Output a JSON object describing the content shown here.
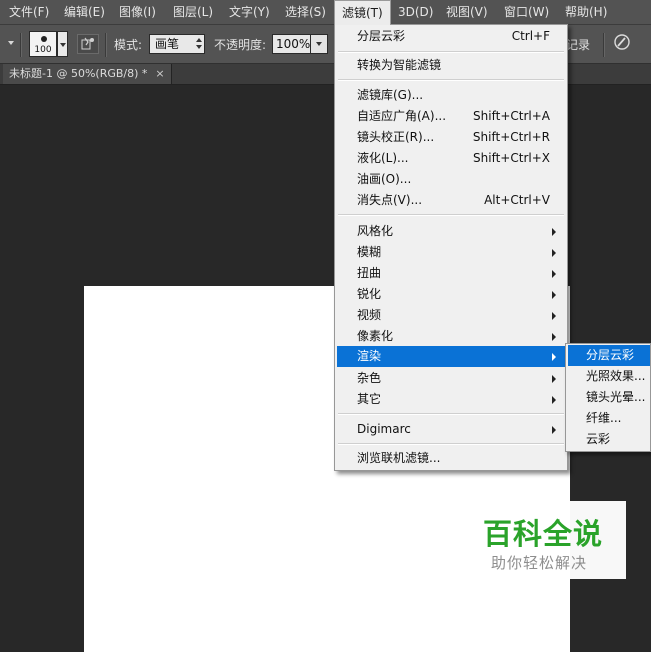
{
  "menubar": {
    "items": [
      {
        "label": "文件(F)"
      },
      {
        "label": "编辑(E)"
      },
      {
        "label": "图像(I)"
      },
      {
        "label": "图层(L)"
      },
      {
        "label": "文字(Y)"
      },
      {
        "label": "选择(S)"
      },
      {
        "label": "滤镜(T)"
      },
      {
        "label": "3D(D)"
      },
      {
        "label": "视图(V)"
      },
      {
        "label": "窗口(W)"
      },
      {
        "label": "帮助(H)"
      }
    ]
  },
  "options": {
    "brush_size": "100",
    "mode_label": "模式:",
    "mode_value": "画笔",
    "opacity_label": "不透明度:",
    "opacity_value": "100%",
    "history_label": "记录"
  },
  "document": {
    "tab_title": "未标题-1 @ 50%(RGB/8) *",
    "close_glyph": "×"
  },
  "filter_menu": {
    "items": [
      {
        "label": "分层云彩",
        "shortcut": "Ctrl+F"
      },
      {
        "label": "转换为智能滤镜",
        "shortcut": ""
      },
      {
        "label": "滤镜库(G)...",
        "shortcut": ""
      },
      {
        "label": "自适应广角(A)...",
        "shortcut": "Shift+Ctrl+A"
      },
      {
        "label": "镜头校正(R)...",
        "shortcut": "Shift+Ctrl+R"
      },
      {
        "label": "液化(L)...",
        "shortcut": "Shift+Ctrl+X"
      },
      {
        "label": "油画(O)...",
        "shortcut": ""
      },
      {
        "label": "消失点(V)...",
        "shortcut": "Alt+Ctrl+V"
      },
      {
        "label": "风格化",
        "shortcut": ""
      },
      {
        "label": "模糊",
        "shortcut": ""
      },
      {
        "label": "扭曲",
        "shortcut": ""
      },
      {
        "label": "锐化",
        "shortcut": ""
      },
      {
        "label": "视频",
        "shortcut": ""
      },
      {
        "label": "像素化",
        "shortcut": ""
      },
      {
        "label": "渲染",
        "shortcut": ""
      },
      {
        "label": "杂色",
        "shortcut": ""
      },
      {
        "label": "其它",
        "shortcut": ""
      },
      {
        "label": "Digimarc",
        "shortcut": ""
      },
      {
        "label": "浏览联机滤镜...",
        "shortcut": ""
      }
    ]
  },
  "render_submenu": {
    "items": [
      {
        "label": "分层云彩"
      },
      {
        "label": "光照效果..."
      },
      {
        "label": "镜头光晕..."
      },
      {
        "label": "纤维..."
      },
      {
        "label": "云彩"
      }
    ]
  },
  "watermark": {
    "title": "百科全说",
    "subtitle": "助你轻松解决"
  },
  "colors": {
    "menu_highlight": "#0a72d6",
    "chrome": "#535353",
    "workspace": "#282828",
    "watermark_green": "#2aa32a"
  }
}
